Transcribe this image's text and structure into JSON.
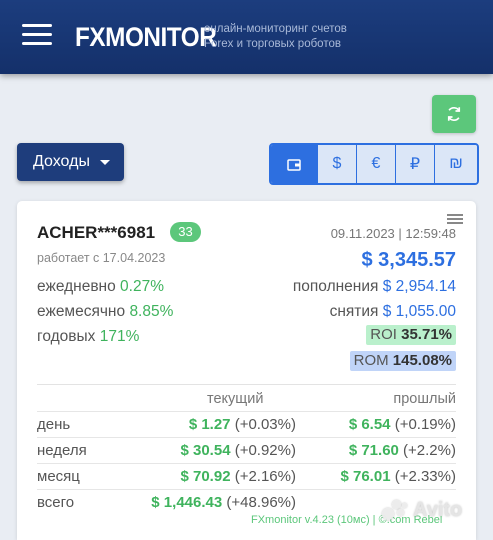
{
  "header": {
    "logo": "FXMONITOR",
    "tagline_line1": "онлайн-мониторинг счетов",
    "tagline_line2": "Forex и торговых роботов"
  },
  "toolbar": {
    "income_label": "Доходы",
    "currencies": [
      "$",
      "€",
      "₽",
      "₪"
    ]
  },
  "account": {
    "name": "ACHER***6981",
    "badge": "33",
    "datetime": "09.11.2023 | 12:59:48",
    "works_since": "работает с 17.04.2023",
    "balance": "$ 3,345.57",
    "daily_label": "ежедневно",
    "daily_value": "0.27%",
    "monthly_label": "ежемесячно",
    "monthly_value": "8.85%",
    "yearly_label": "годовых",
    "yearly_value": "171%",
    "deposits_label": "пополнения",
    "deposits_value": "$ 2,954.14",
    "withdrawals_label": "снятия",
    "withdrawals_value": "$ 1,055.00",
    "roi_label": "ROI",
    "roi_value": "35.71%",
    "rom_label": "ROM",
    "rom_value": "145.08%"
  },
  "table": {
    "col_current": "текущий",
    "col_previous": "прошлый",
    "rows": [
      {
        "label": "день",
        "cur_amount": "$ 1.27",
        "cur_pct": "(+0.03%)",
        "prev_amount": "$ 6.54",
        "prev_pct": "(+0.19%)"
      },
      {
        "label": "неделя",
        "cur_amount": "$ 30.54",
        "cur_pct": "(+0.92%)",
        "prev_amount": "$ 71.60",
        "prev_pct": "(+2.2%)"
      },
      {
        "label": "месяц",
        "cur_amount": "$ 70.92",
        "cur_pct": "(+2.16%)",
        "prev_amount": "$ 76.01",
        "prev_pct": "(+2.33%)"
      },
      {
        "label": "всего",
        "cur_amount": "$ 1,446.43",
        "cur_pct": "(+48.96%)"
      }
    ]
  },
  "footer": {
    "version": "FXmonitor v.4.23 (10мс) | ©.com Rebel",
    "watermark": "Avito"
  },
  "colors": {
    "header_bg": "#1c3d7e",
    "accent_blue": "#2d6fe0",
    "accent_green": "#3fb35d",
    "refresh_green": "#5cc77b"
  },
  "icons": {
    "menu": "hamburger-icon",
    "refresh": "refresh-icon",
    "wallet": "wallet-icon",
    "card_menu": "list-icon"
  }
}
